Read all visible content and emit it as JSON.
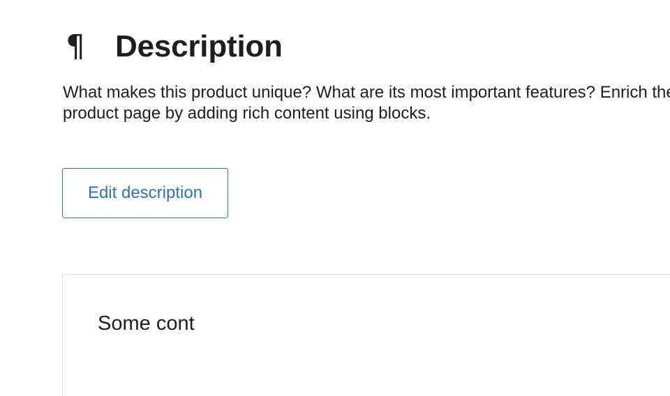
{
  "section": {
    "icon": "pilcrow-icon",
    "icon_glyph": "¶",
    "title": "Description",
    "help_text": "What makes this product unique? What are its most important features? Enrich the product page by adding rich content using blocks."
  },
  "actions": {
    "edit_label": "Edit description"
  },
  "preview": {
    "content_text": "Some cont"
  },
  "colors": {
    "accent": "#3072ad",
    "text": "#1e1e1e",
    "border": "#dcdcde"
  }
}
